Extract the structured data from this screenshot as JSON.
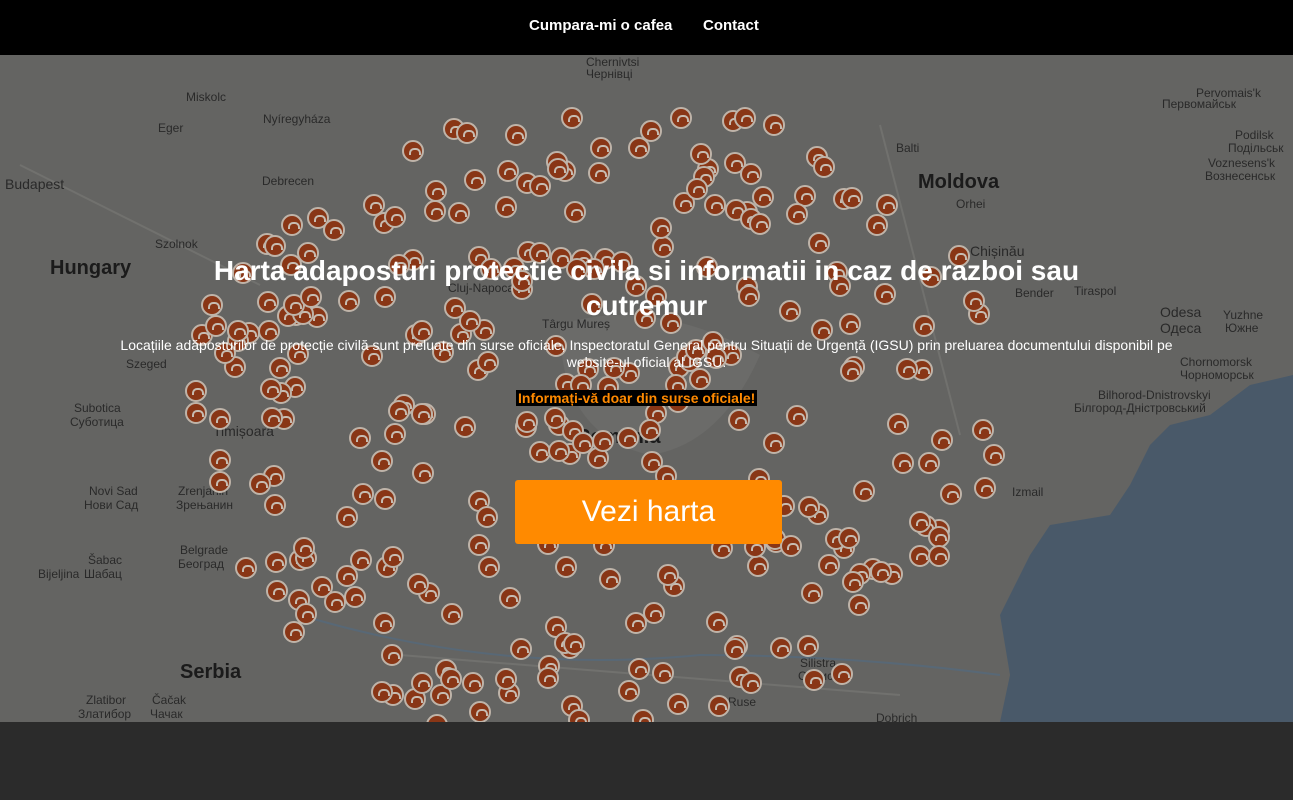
{
  "nav": {
    "items": [
      {
        "label": "Cumpara-mi o cafea"
      },
      {
        "label": "Contact"
      }
    ]
  },
  "hero": {
    "title": "Harta adaposturi protectie civila si informatii in caz de razboi sau cutremur",
    "subtitle": "Locațiile adăposturilor de protecție civilă sunt preluate din surse oficiale, Inspectoratul General pentru Situații de Urgență (IGSU) prin preluarea documentului disponibil pe website-ul oficial al IGSU.",
    "warning": "Informați-vă doar din surse oficiale!",
    "cta_label": "Vezi harta"
  },
  "map": {
    "labels": [
      "Miskolc",
      "Nyíregyháza",
      "Eger",
      "Budapest",
      "Debrecen",
      "Hungary",
      "Szolnok",
      "Szeged",
      "Subotica",
      "Суботица",
      "Novi Sad",
      "Нови Сад",
      "Zrenjanin",
      "Зрењанин",
      "Belgrade",
      "Београд",
      "Šabac",
      "Шабац",
      "Bijeljina",
      "Serbia",
      "Zlatibor",
      "Златибор",
      "Čačak",
      "Чачак",
      "Chernivtsi",
      "Чернівці",
      "Balti",
      "Moldova",
      "Orhei",
      "Chișinău",
      "Bender",
      "Tiraspol",
      "Odesa",
      "Одеса",
      "Yuzhne",
      "Южне",
      "Chornomorsk",
      "Чорноморськ",
      "Bilhorod-Dnistrovskyi",
      "Білгород-Дністровський",
      "Izmail",
      "Pervomais'k",
      "Первомайськ",
      "Podilsk",
      "Подільськ",
      "Voznesens'k",
      "Вознесенськ",
      "Cluj-Napoca",
      "Târgu Mureș",
      "Timișoara",
      "Romania",
      "Silistra",
      "Силистра",
      "Dobrich",
      "Ruse"
    ],
    "pin_count": 300,
    "colors": {
      "pin": "#a8431b",
      "pin_ring": "#e9dccf",
      "land": "#7b7b78",
      "sea": "#5a6d80"
    }
  },
  "colors": {
    "accent": "#ff8a00",
    "nav_bg": "#000000",
    "footer_bg": "#2b2b2b"
  }
}
